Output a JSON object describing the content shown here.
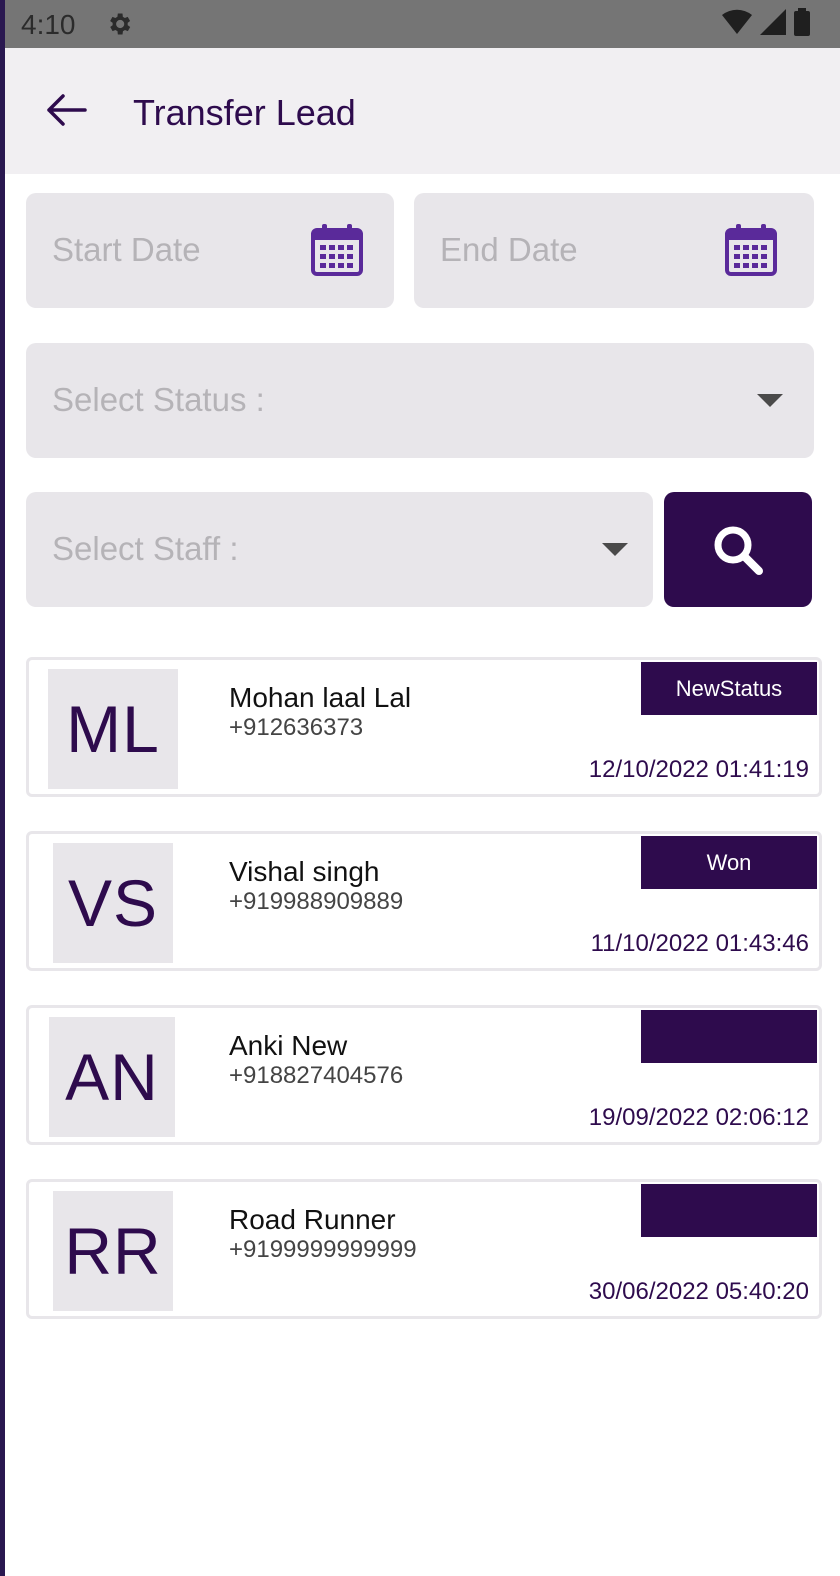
{
  "status_bar": {
    "time": "4:10",
    "icons": [
      "gear-icon",
      "wifi-icon",
      "signal-icon",
      "battery-icon"
    ]
  },
  "app_bar": {
    "title": "Transfer Lead",
    "back_icon": "arrow-left-icon"
  },
  "filters": {
    "start_date_placeholder": "Start Date",
    "end_date_placeholder": "End Date",
    "status_placeholder": "Select Status :",
    "staff_placeholder": "Select Staff :",
    "search_icon": "search-icon"
  },
  "leads": [
    {
      "initials": "ML",
      "name": "Mohan laal Lal",
      "phone": "+912636373",
      "status": "NewStatus",
      "datetime": "12/10/2022 01:41:19"
    },
    {
      "initials": "VS",
      "name": "Vishal singh",
      "phone": "+919988909889",
      "status": "Won",
      "datetime": "11/10/2022 01:43:46"
    },
    {
      "initials": "AN",
      "name": "Anki New",
      "phone": "+918827404576",
      "status": "",
      "datetime": "19/09/2022 02:06:12"
    },
    {
      "initials": "RR",
      "name": "Road Runner",
      "phone": "+9199999999999",
      "status": "",
      "datetime": "30/06/2022 05:40:20"
    }
  ],
  "colors": {
    "primary": "#2e0b4d",
    "field_bg": "#e8e6ea",
    "appbar_bg": "#f1eff2",
    "statusbar_bg": "#757575",
    "calendar_icon": "#5a2a9a"
  }
}
